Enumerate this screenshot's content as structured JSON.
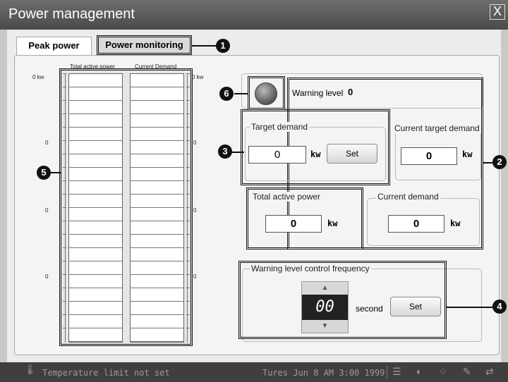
{
  "window": {
    "title": "Power management",
    "close": "X"
  },
  "tabs": {
    "peak": "Peak power",
    "monitoring": "Power monitoring"
  },
  "callouts": {
    "c1": "1",
    "c2": "2",
    "c3": "3",
    "c4": "4",
    "c5": "5",
    "c6": "6"
  },
  "chart": {
    "h_total": "Total active power",
    "h_current": "Current Demand",
    "top_left": "0 kw",
    "top_right": "0 kw",
    "s1": "0",
    "s2": "0",
    "s3": "0"
  },
  "warning": {
    "label": "Warning level",
    "value": "0"
  },
  "target": {
    "title": "Target demand",
    "value": "0",
    "unit": "kw",
    "set": "Set"
  },
  "current_target": {
    "title": "Current target demand",
    "value": "0",
    "unit": "kw"
  },
  "total_active": {
    "title": "Total active power",
    "value": "0",
    "unit": "kw"
  },
  "current_demand": {
    "title": "Current demand",
    "value": "0",
    "unit": "kw"
  },
  "frequency": {
    "title": "Warning level control frequency",
    "value": "00",
    "unit": "second",
    "set": "Set"
  },
  "status": {
    "message": "Temperature limit not set",
    "datetime": "Tures Jun 8 AM 3:00 1999"
  }
}
